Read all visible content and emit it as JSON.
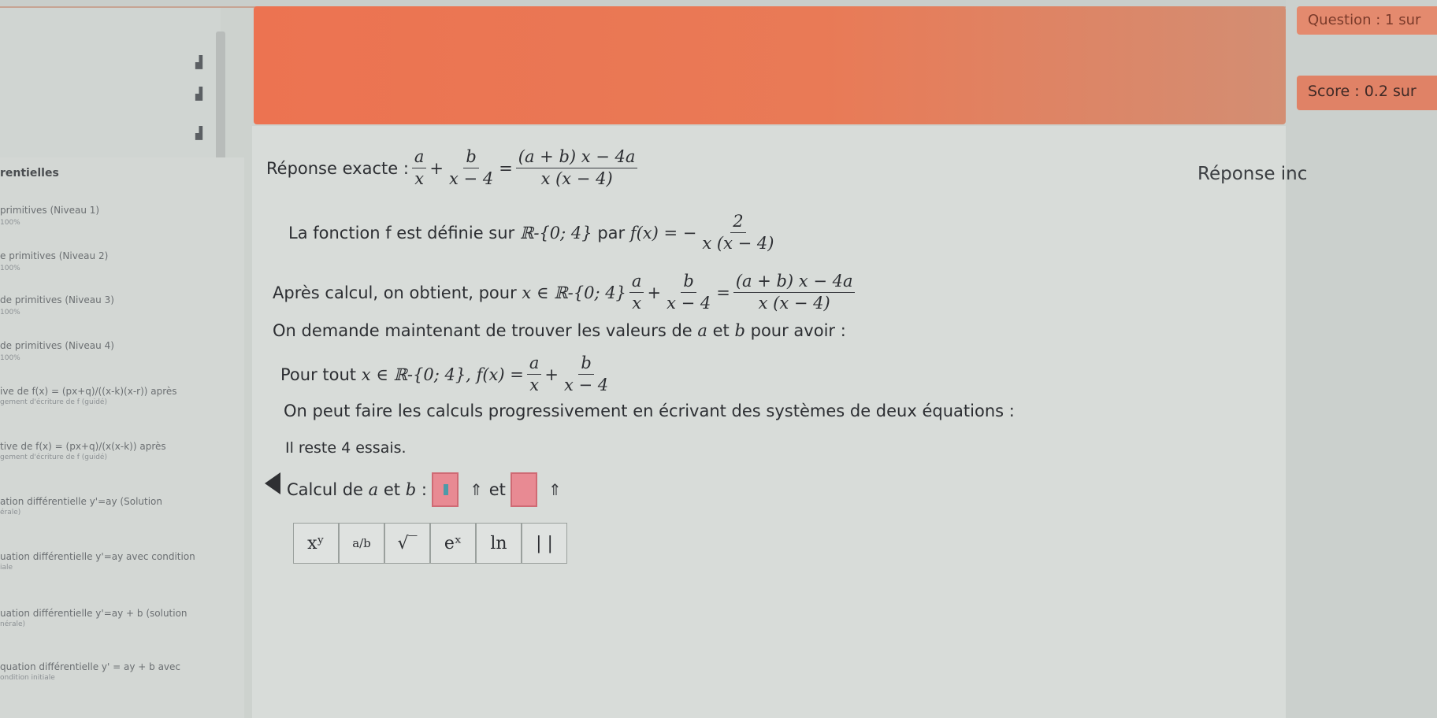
{
  "header": {
    "question_label": "Question : 1 sur",
    "score_label": "Score : 0.2 sur",
    "icons": [
      "chart-icon",
      "chart-icon",
      "chart-icon"
    ]
  },
  "sidebar": {
    "title": "rentielles",
    "items": [
      {
        "label": "primitives (Niveau 1)",
        "sub": "100%"
      },
      {
        "label": "e primitives (Niveau 2)",
        "sub": "100%"
      },
      {
        "label": "de primitives (Niveau 3)",
        "sub": "100%"
      },
      {
        "label": "de primitives (Niveau 4)",
        "sub": "100%"
      },
      {
        "label": "ive de f(x) = (px+q)/((x-k)(x-r)) après",
        "sub": "gement d'écriture de f (guidé)"
      },
      {
        "label": "tive de f(x) = (px+q)/(x(x-k)) après",
        "sub": "gement d'écriture de f (guidé)"
      },
      {
        "label": "ation différentielle y'=ay (Solution",
        "sub": "érale)"
      },
      {
        "label": "uation différentielle y'=ay avec condition",
        "sub": "iale"
      },
      {
        "label": "uation différentielle y'=ay + b (solution",
        "sub": "nérale)"
      },
      {
        "label": "quation différentielle y' = ay + b avec",
        "sub": "ondition initiale"
      }
    ]
  },
  "content": {
    "reponse_exacte_label": "Réponse exacte :",
    "reponse_incorrecte_label": "Réponse inc",
    "fonction_line": "La fonction f est définie sur",
    "fonction_par": "par",
    "apres_calcul": "Après calcul, on obtient, pour",
    "on_demande": "On demande maintenant de trouver les valeurs de",
    "on_demande_suffix": "pour avoir :",
    "pour_tout": "Pour tout",
    "on_peut": "On peut faire les calculs progressivement en écrivant des systèmes de deux équations :",
    "il_reste": "Il reste 4 essais.",
    "calcul_label": "Calcul de",
    "et": "et",
    "var_a": "a",
    "var_b": "b",
    "domain_text": "ℝ-{0; 4}",
    "toggle_glyph": "⇑"
  },
  "toolbar": {
    "buttons": [
      "xʸ",
      "a/b",
      "√‾",
      "eˣ",
      "ln",
      "| |"
    ]
  },
  "colors": {
    "banner": "#ec7351",
    "input_box": "#e88a93",
    "score_badge": "#e08266"
  }
}
